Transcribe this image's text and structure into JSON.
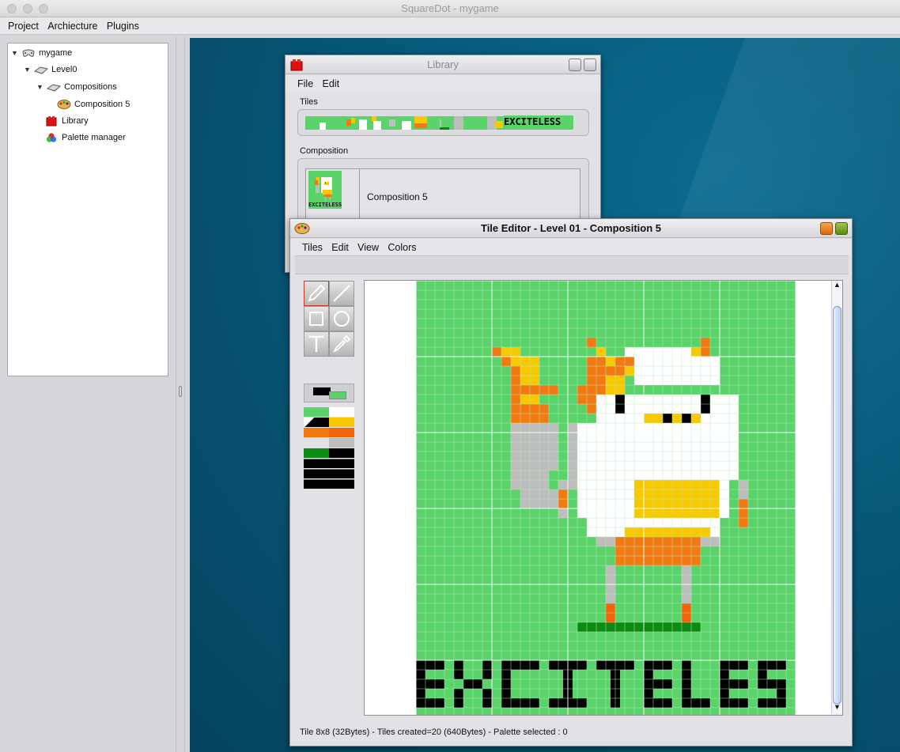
{
  "app": {
    "title": "SquareDot - mygame"
  },
  "menubar": {
    "items": [
      "Project",
      "Archiecture",
      "Plugins"
    ]
  },
  "tree": {
    "root": "mygame",
    "level": "Level0",
    "compositions": "Compositions",
    "composition_item": "Composition 5",
    "library": "Library",
    "palette_manager": "Palette manager"
  },
  "library_window": {
    "title": "Library",
    "menu": [
      "File",
      "Edit"
    ],
    "tiles_label": "Tiles",
    "tiles_text": "EXCITELESS",
    "composition_label": "Composition",
    "composition_name": "Composition 5",
    "thumb_text": "EXCITELESS"
  },
  "tile_editor": {
    "title": "Tile Editor - Level 01 - Composition 5",
    "menu": [
      "Tiles",
      "Edit",
      "View",
      "Colors"
    ],
    "status": "Tile 8x8 (32Bytes) - Tiles created=20 (640Bytes) - Palette selected : 0",
    "tools": [
      "pencil-tool",
      "line-tool",
      "rectangle-tool",
      "circle-tool",
      "text-tool",
      "eyedropper-tool"
    ]
  },
  "colors": {
    "green": "#5ad36a",
    "white": "#ffffff",
    "yellow": "#f8c800",
    "orange": "#f27a12",
    "dark_orange": "#f0640a",
    "gray": "#bdbdbd",
    "black": "#000000",
    "dark_green": "#0c8a12"
  }
}
